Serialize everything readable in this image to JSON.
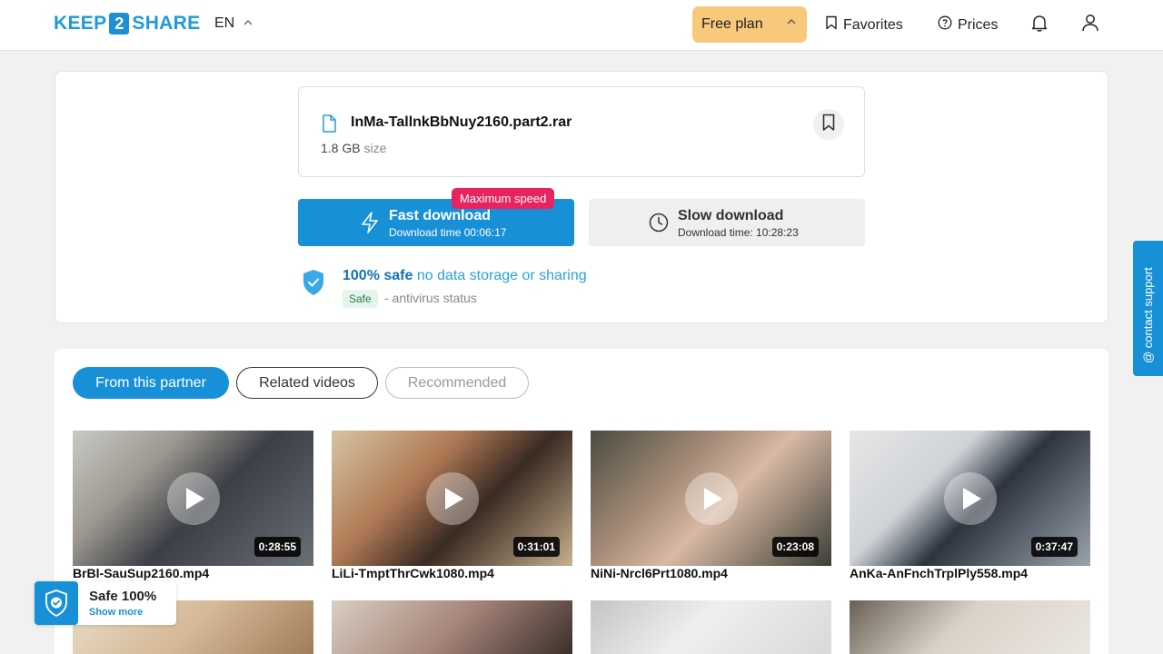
{
  "header": {
    "logo_left": "KEEP",
    "logo_mid": "2",
    "logo_right": "SHARE",
    "language": "EN",
    "plan_label": "Free plan",
    "favorites_label": "Favorites",
    "prices_label": "Prices"
  },
  "file": {
    "name": "InMa-TallnkBbNuy2160.part2.rar",
    "size_value": "1.8 GB",
    "size_label": "size"
  },
  "download": {
    "fast_title": "Fast download",
    "fast_sub": "Download time 00:06:17",
    "max_speed_badge": "Maximum speed",
    "slow_title": "Slow download",
    "slow_sub": "Download time: 10:28:23"
  },
  "safety": {
    "strong": "100% safe",
    "rest": " no data storage or sharing",
    "badge": "Safe",
    "antivirus": "- antivirus status"
  },
  "tabs": [
    {
      "label": "From this partner",
      "active": true
    },
    {
      "label": "Related videos",
      "active": false
    },
    {
      "label": "Recommended",
      "active": false
    }
  ],
  "videos": [
    {
      "title": "BrBl-SauSup2160.mp4",
      "duration": "0:28:55"
    },
    {
      "title": "LiLi-TmptThrCwk1080.mp4",
      "duration": "0:31:01"
    },
    {
      "title": "NiNi-Nrcl6Prt1080.mp4",
      "duration": "0:23:08"
    },
    {
      "title": "AnKa-AnFnchTrplPly558.mp4",
      "duration": "0:37:47"
    }
  ],
  "support_label": "contact support",
  "safe_float": {
    "title": "Safe 100%",
    "link": "Show more"
  },
  "colors": {
    "brand_blue": "#1890d8",
    "plan_bg": "#f7c97a",
    "badge_pink": "#e8245f"
  }
}
